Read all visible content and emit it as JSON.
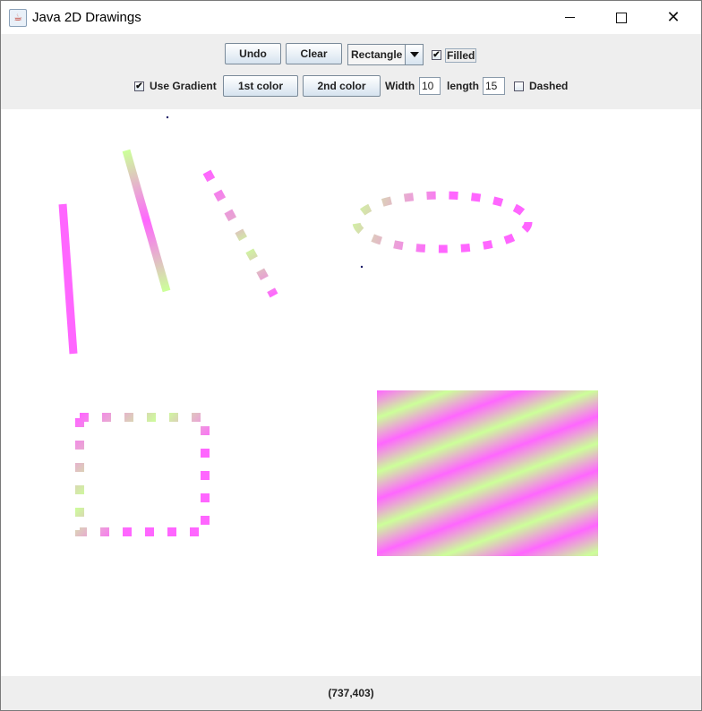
{
  "window": {
    "title": "Java 2D Drawings"
  },
  "toolbar": {
    "undo_label": "Undo",
    "clear_label": "Clear",
    "shape_selected": "Rectangle",
    "filled_label": "Filled",
    "filled_checked": true,
    "use_gradient_label": "Use Gradient",
    "use_gradient_checked": true,
    "color1_label": "1st color",
    "color2_label": "2nd color",
    "width_label": "Width",
    "width_value": "10",
    "length_label": "length",
    "length_value": "15",
    "dashed_label": "Dashed",
    "dashed_checked": false
  },
  "status": {
    "coordinates": "(737,403)"
  },
  "colors": {
    "gradient_color_1": "#ff66ff",
    "gradient_color_2": "#ccff99",
    "dot_color": "#1a1a66"
  }
}
